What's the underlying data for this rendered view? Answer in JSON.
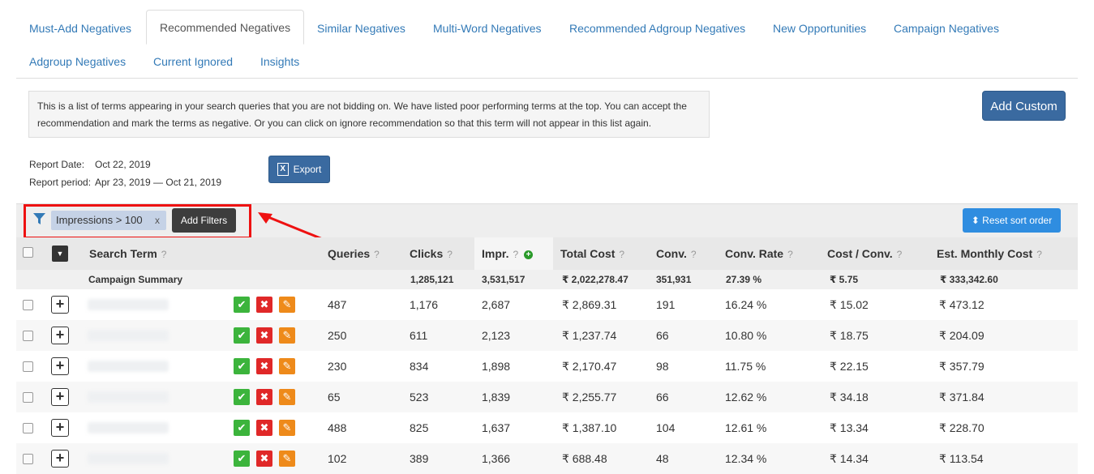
{
  "tabs": [
    {
      "label": "Must-Add Negatives",
      "active": false
    },
    {
      "label": "Recommended Negatives",
      "active": true
    },
    {
      "label": "Similar Negatives",
      "active": false
    },
    {
      "label": "Multi-Word Negatives",
      "active": false
    },
    {
      "label": "Recommended Adgroup Negatives",
      "active": false
    },
    {
      "label": "New Opportunities",
      "active": false
    },
    {
      "label": "Campaign Negatives",
      "active": false
    },
    {
      "label": "Adgroup Negatives",
      "active": false
    },
    {
      "label": "Current Ignored",
      "active": false
    },
    {
      "label": "Insights",
      "active": false
    }
  ],
  "info_text": "This is a list of terms appearing in your search queries that you are not bidding on. We have listed poor performing terms at the top. You can accept the recommendation and mark the terms as negative. Or you can click on ignore recommendation so that this term will not appear in this list again.",
  "add_custom_label": "Add Custom",
  "report": {
    "date_label": "Report Date:",
    "date_value": "Oct 22, 2019",
    "period_label": "Report period:",
    "period_value": "Apr 23, 2019 — Oct 21, 2019"
  },
  "export_label": "Export",
  "filters": {
    "chip_label": "Impressions > 100",
    "chip_remove": "x",
    "add_filters_label": "Add Filters",
    "reset_sort_label": "Reset sort order"
  },
  "columns": {
    "search_term": "Search Term",
    "queries": "Queries",
    "clicks": "Clicks",
    "impr": "Impr.",
    "total_cost": "Total Cost",
    "conv": "Conv.",
    "conv_rate": "Conv. Rate",
    "cost_conv": "Cost / Conv.",
    "est_monthly_cost": "Est. Monthly Cost",
    "help_mark": "?"
  },
  "summary": {
    "label": "Campaign Summary",
    "clicks": "1,285,121",
    "impr": "3,531,517",
    "total_cost": "₹ 2,022,278.47",
    "conv": "351,931",
    "conv_rate": "27.39 %",
    "cost_conv": "₹ 5.75",
    "est_monthly_cost": "₹ 333,342.60"
  },
  "rows": [
    {
      "queries": "487",
      "clicks": "1,176",
      "impr": "2,687",
      "total_cost": "₹ 2,869.31",
      "conv": "191",
      "conv_rate": "16.24 %",
      "cost_conv": "₹ 15.02",
      "est_monthly_cost": "₹ 473.12"
    },
    {
      "queries": "250",
      "clicks": "611",
      "impr": "2,123",
      "total_cost": "₹ 1,237.74",
      "conv": "66",
      "conv_rate": "10.80 %",
      "cost_conv": "₹ 18.75",
      "est_monthly_cost": "₹ 204.09"
    },
    {
      "queries": "230",
      "clicks": "834",
      "impr": "1,898",
      "total_cost": "₹ 2,170.47",
      "conv": "98",
      "conv_rate": "11.75 %",
      "cost_conv": "₹ 22.15",
      "est_monthly_cost": "₹ 357.79"
    },
    {
      "queries": "65",
      "clicks": "523",
      "impr": "1,839",
      "total_cost": "₹ 2,255.77",
      "conv": "66",
      "conv_rate": "12.62 %",
      "cost_conv": "₹ 34.18",
      "est_monthly_cost": "₹ 371.84"
    },
    {
      "queries": "488",
      "clicks": "825",
      "impr": "1,637",
      "total_cost": "₹ 1,387.10",
      "conv": "104",
      "conv_rate": "12.61 %",
      "cost_conv": "₹ 13.34",
      "est_monthly_cost": "₹ 228.70"
    },
    {
      "queries": "102",
      "clicks": "389",
      "impr": "1,366",
      "total_cost": "₹ 688.48",
      "conv": "48",
      "conv_rate": "12.34 %",
      "cost_conv": "₹ 14.34",
      "est_monthly_cost": "₹ 113.54"
    }
  ],
  "colors": {
    "link": "#337ab7",
    "primary_dark": "#3a6aa0",
    "reset_blue": "#2f8de0",
    "accept_green": "#3cb43c",
    "ignore_red": "#e02828",
    "edit_orange": "#ee8a1a",
    "highlight_red": "#e11111"
  },
  "icons": {
    "accept": "✔",
    "ignore": "✖",
    "edit": "✎",
    "expand": "+",
    "sort_up_down": "⬍",
    "dropdown": "▼",
    "add_circle": "+"
  }
}
